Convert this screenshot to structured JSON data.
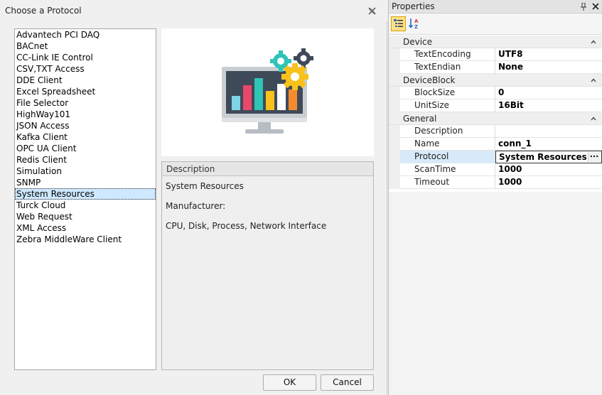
{
  "dialog": {
    "title": "Choose a Protocol",
    "protocols": [
      "Advantech PCI DAQ",
      "BACnet",
      "CC-Link IE Control",
      "CSV,TXT Access",
      "DDE Client",
      "Excel Spreadsheet",
      "File Selector",
      "HighWay101",
      "JSON Access",
      "Kafka Client",
      "OPC UA Client",
      "Redis Client",
      "Simulation",
      "SNMP",
      "System Resources",
      "Turck Cloud",
      "Web Request",
      "XML Access",
      "Zebra MiddleWare Client"
    ],
    "selected_protocol": "System Resources",
    "description": {
      "header": "Description",
      "name": "System Resources",
      "manufacturer": "Manufacturer:",
      "details": "CPU, Disk, Process, Network Interface"
    },
    "ok_label": "OK",
    "cancel_label": "Cancel"
  },
  "properties": {
    "title": "Properties",
    "categories": [
      {
        "name": "Device",
        "rows": [
          {
            "name": "TextEncoding",
            "value": "UTF8"
          },
          {
            "name": "TextEndian",
            "value": "None"
          }
        ]
      },
      {
        "name": "DeviceBlock",
        "rows": [
          {
            "name": "BlockSize",
            "value": "0"
          },
          {
            "name": "UnitSize",
            "value": "16Bit"
          }
        ]
      },
      {
        "name": "General",
        "rows": [
          {
            "name": "Description",
            "value": ""
          },
          {
            "name": "Name",
            "value": "conn_1"
          },
          {
            "name": "Protocol",
            "value": "System Resources"
          },
          {
            "name": "ScanTime",
            "value": "1000"
          },
          {
            "name": "Timeout",
            "value": "1000"
          }
        ]
      }
    ],
    "ellipsis": "..."
  },
  "colors": {
    "selection": "#cde8ff",
    "toolbar_active": "#ffe08a"
  },
  "icons": {
    "dialog_close": "close-x-icon",
    "pin": "pin-icon",
    "props_close": "close-icon",
    "categorized": "categorized-view-icon",
    "alphabetical": "sort-alphabetical-icon",
    "preview": "monitor-chart-gears-illustration"
  }
}
